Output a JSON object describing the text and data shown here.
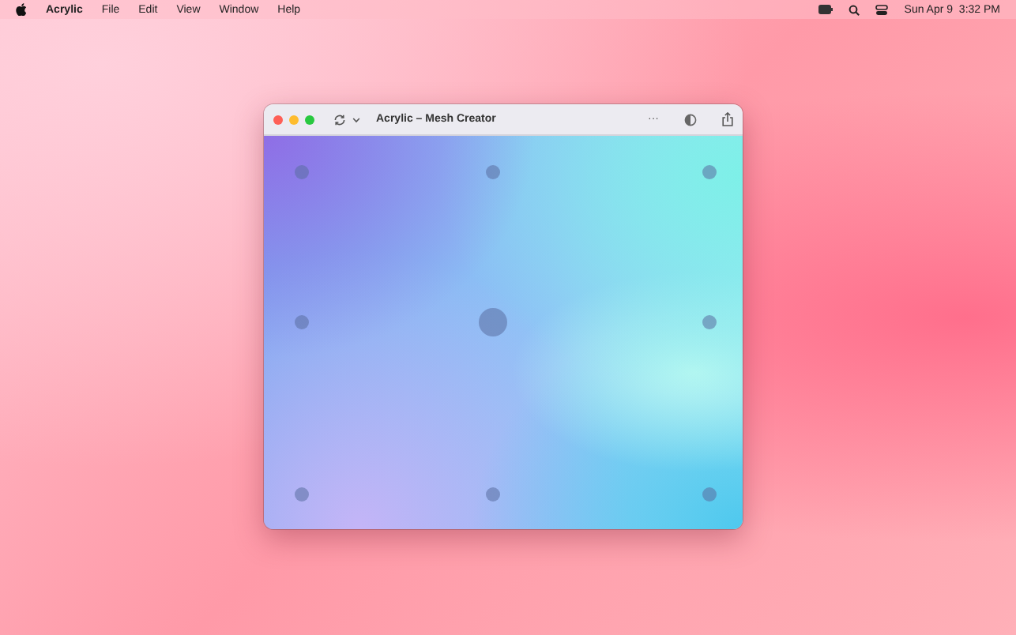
{
  "menu_bar": {
    "app_name": "Acrylic",
    "menus": [
      "File",
      "Edit",
      "View",
      "Window",
      "Help"
    ],
    "clock": "Sun Apr 9  3:32 PM"
  },
  "window": {
    "title": "Acrylic – Mesh Creator",
    "more_button": "···"
  },
  "mesh_points": [
    {
      "selected": false
    },
    {
      "selected": false
    },
    {
      "selected": false
    },
    {
      "selected": false
    },
    {
      "selected": true
    },
    {
      "selected": false
    },
    {
      "selected": false
    },
    {
      "selected": false
    },
    {
      "selected": false
    }
  ]
}
